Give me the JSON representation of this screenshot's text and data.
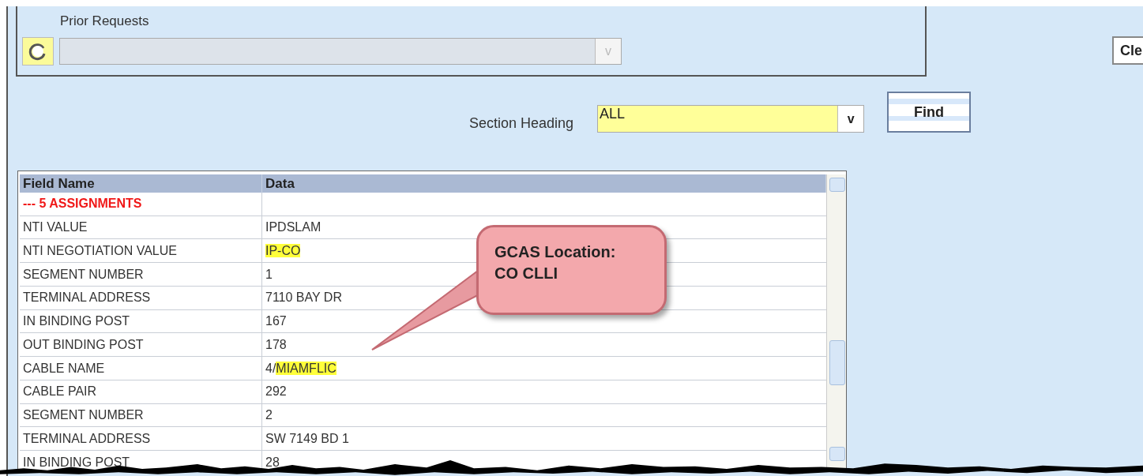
{
  "prior_requests": {
    "label": "Prior Requests",
    "dropdown": {
      "disabled": true,
      "arrow": "v"
    }
  },
  "clear_button": {
    "label": "Cle"
  },
  "section_heading": {
    "label": "Section Heading",
    "value": "ALL",
    "arrow": "v"
  },
  "find_button": {
    "label": "Find"
  },
  "table": {
    "columns": [
      "Field Name",
      "Data"
    ],
    "rows": [
      {
        "kind": "section",
        "field": "--- 5 ASSIGNMENTS"
      },
      {
        "kind": "field",
        "field": "NTI VALUE",
        "data": [
          {
            "text": "IPDSLAM",
            "highlighted": false
          }
        ]
      },
      {
        "kind": "field",
        "field": "NTI NEGOTIATION VALUE",
        "data": [
          {
            "text": "IP-CO",
            "highlighted": true
          }
        ]
      },
      {
        "kind": "field",
        "field": "SEGMENT NUMBER",
        "data": [
          {
            "text": "1",
            "highlighted": false
          }
        ]
      },
      {
        "kind": "field",
        "field": "TERMINAL ADDRESS",
        "data": [
          {
            "text": "7110 BAY DR",
            "highlighted": false
          }
        ]
      },
      {
        "kind": "field",
        "field": "IN BINDING POST",
        "data": [
          {
            "text": "167",
            "highlighted": false
          }
        ]
      },
      {
        "kind": "field",
        "field": "OUT BINDING POST",
        "data": [
          {
            "text": "178",
            "highlighted": false
          }
        ]
      },
      {
        "kind": "field",
        "field": "CABLE NAME",
        "data": [
          {
            "text": "4/",
            "highlighted": false
          },
          {
            "text": "MIAMFLIC",
            "highlighted": true
          }
        ]
      },
      {
        "kind": "field",
        "field": "CABLE PAIR",
        "data": [
          {
            "text": "292",
            "highlighted": false
          }
        ]
      },
      {
        "kind": "field",
        "field": "SEGMENT NUMBER",
        "data": [
          {
            "text": "2",
            "highlighted": false
          }
        ]
      },
      {
        "kind": "field",
        "field": "TERMINAL ADDRESS",
        "data": [
          {
            "text": "SW 7149 BD 1",
            "highlighted": false
          }
        ]
      },
      {
        "kind": "field",
        "field": "IN BINDING POST",
        "data": [
          {
            "text": "28",
            "highlighted": false
          }
        ]
      }
    ]
  },
  "callout": {
    "lines": [
      "GCAS Location:",
      "CO CLLI"
    ]
  }
}
